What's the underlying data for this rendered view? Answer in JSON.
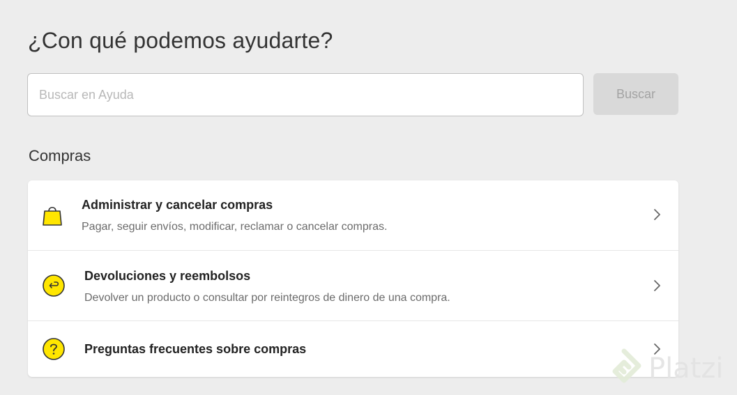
{
  "header": {
    "title": "¿Con qué podemos ayudarte?"
  },
  "search": {
    "placeholder": "Buscar en Ayuda",
    "value": "",
    "button_label": "Buscar"
  },
  "section": {
    "title": "Compras",
    "items": [
      {
        "icon": "shopping-bag-icon",
        "title": "Administrar y cancelar compras",
        "description": "Pagar, seguir envíos, modificar, reclamar o cancelar compras."
      },
      {
        "icon": "return-arrow-icon",
        "title": "Devoluciones y reembolsos",
        "description": "Devolver un producto o consultar por reintegros de dinero de una compra."
      },
      {
        "icon": "question-mark-icon",
        "title": "Preguntas frecuentes sobre compras",
        "description": ""
      }
    ]
  },
  "watermark": {
    "text": "Platzi"
  },
  "colors": {
    "background": "#ededed",
    "card": "#ffffff",
    "accent_yellow": "#ffe600",
    "button_disabled": "#d9d9d9"
  }
}
